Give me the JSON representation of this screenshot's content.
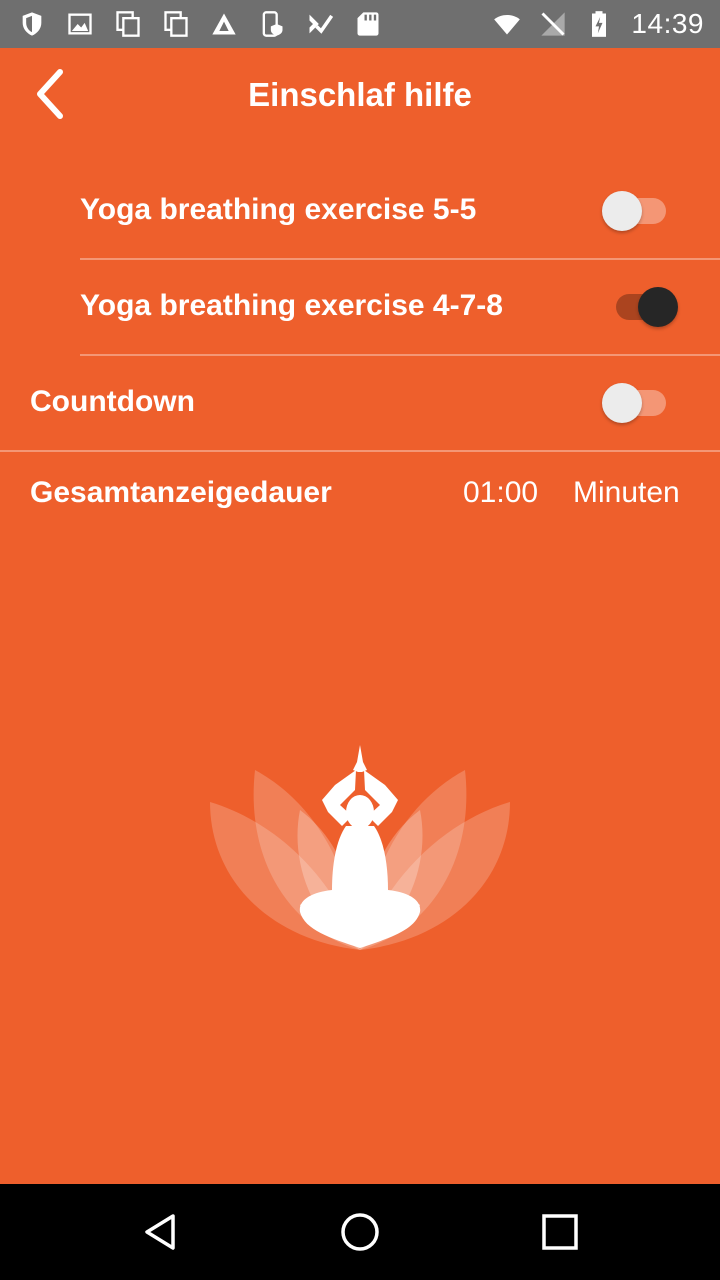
{
  "status_bar": {
    "time": "14:39",
    "left_icons": [
      "shield-icon",
      "image-icon",
      "copy-icon",
      "copy-icon",
      "triangle-logo-icon",
      "phone-shield-icon",
      "checkmark-flag-icon",
      "sd-card-icon"
    ],
    "right_icons": [
      "wifi-icon",
      "no-signal-icon",
      "battery-charging-icon"
    ]
  },
  "header": {
    "title": "Einschlaf hilfe"
  },
  "settings": {
    "yoga_55": {
      "label": "Yoga breathing exercise 5-5",
      "enabled": false
    },
    "yoga_478": {
      "label": "Yoga breathing exercise 4-7-8",
      "enabled": true
    },
    "countdown": {
      "label": "Countdown",
      "enabled": false
    },
    "duration": {
      "label": "Gesamtanzeigedauer",
      "value": "01:00",
      "unit": "Minuten"
    }
  },
  "colors": {
    "background": "#EE5F2C",
    "switch_on_thumb": "#262626",
    "switch_off_thumb": "#ECECEC"
  },
  "navigation": {
    "icons": [
      "back-triangle-icon",
      "home-circle-icon",
      "recents-square-icon"
    ]
  }
}
